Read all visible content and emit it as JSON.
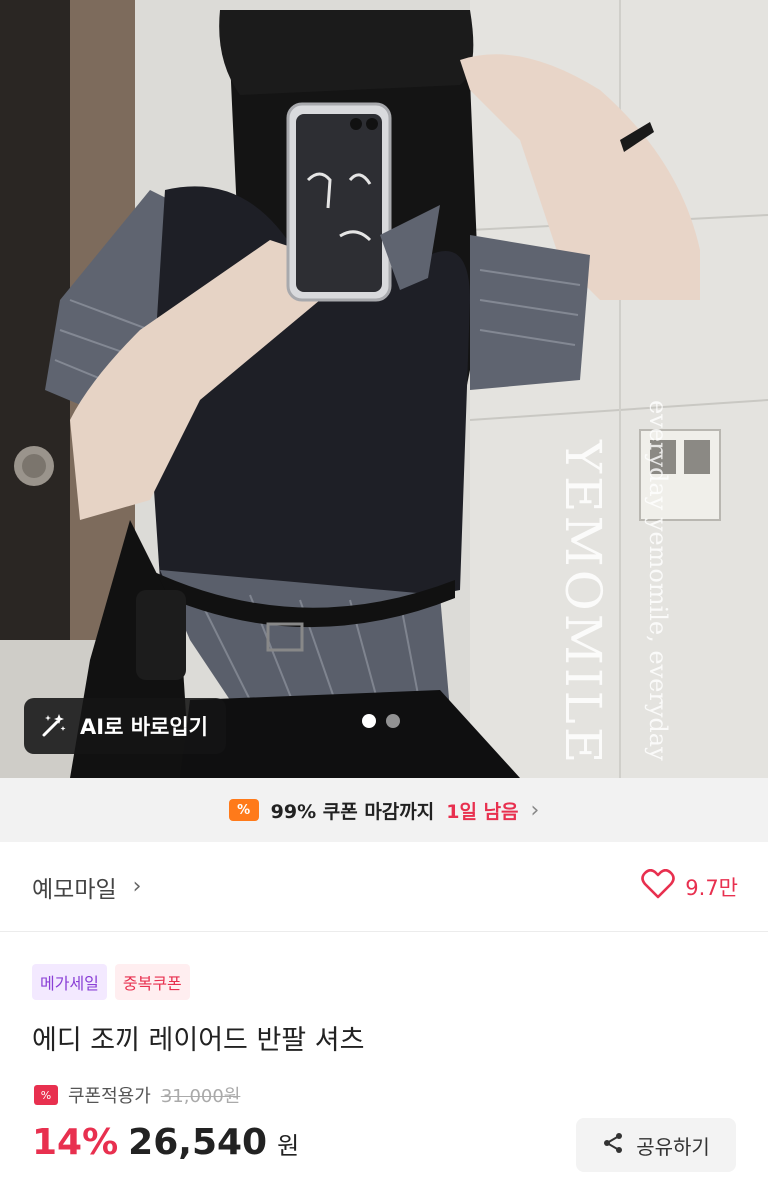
{
  "hero": {
    "watermark_main": "YEMOMILE",
    "watermark_sub": "everyday yemomile, everyday",
    "ai_button_label": "AI로 바로입기",
    "carousel": {
      "total": 2,
      "current": 1
    }
  },
  "coupon_banner": {
    "icon_text": "%",
    "prefix": "99% 쿠폰 마감까지",
    "highlight": "1일 남음",
    "chevron": "›"
  },
  "shop": {
    "name": "예모마일",
    "chevron": "›",
    "like_count": "9.7만"
  },
  "product": {
    "badges": [
      "메가세일",
      "중복쿠폰"
    ],
    "title": "에디 조끼 레이어드 반팔 셔츠",
    "coupon_label": "쿠폰적용가",
    "original_price": "31,000원",
    "discount": "14%",
    "price": "26,540",
    "currency": "원",
    "share_label": "공유하기"
  },
  "colors": {
    "accent": "#e8304f",
    "coupon_orange": "#ff7a1a",
    "badge_purple": "#8a3fd6"
  }
}
